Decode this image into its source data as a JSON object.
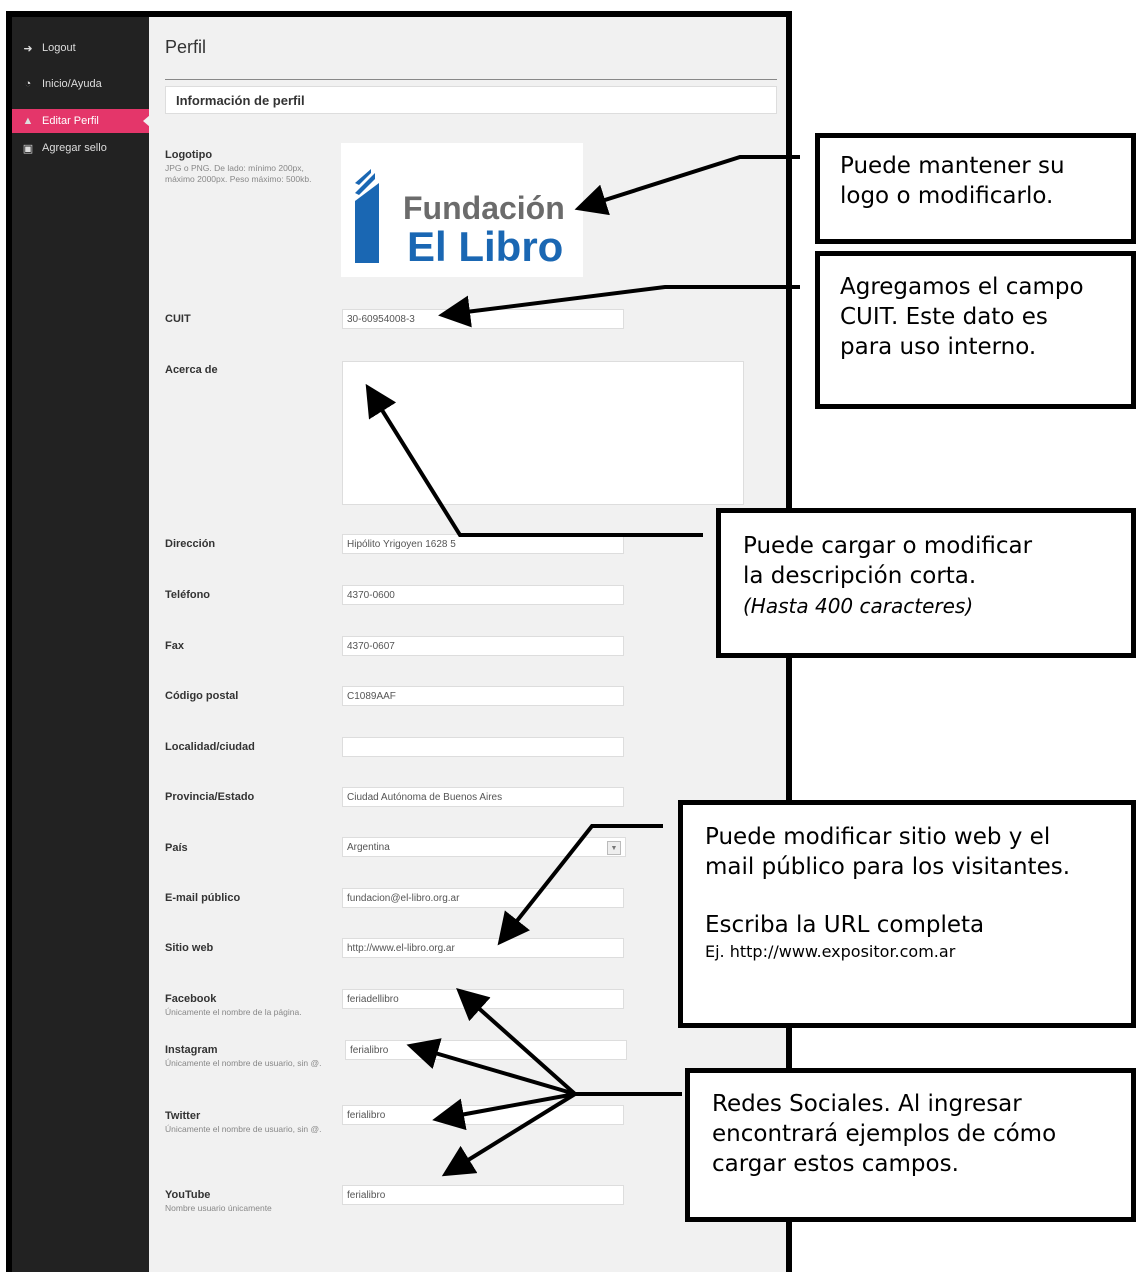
{
  "sidebar": {
    "items": [
      {
        "label": "Logout",
        "icon": "logout-icon"
      },
      {
        "label": "Inicio/Ayuda",
        "icon": "dashboard-icon"
      },
      {
        "label": "Editar Perfil",
        "icon": "user-icon"
      },
      {
        "label": "Agregar sello",
        "icon": "stamp-icon"
      }
    ],
    "active_color": "#e4366a"
  },
  "main": {
    "title": "Perfil",
    "section": "Información de perfil",
    "logo": {
      "label": "Logotipo",
      "hint": "JPG o PNG. De lado: mínimo 200px, máximo 2000px. Peso máximo: 500kb.",
      "brand_line1": "Fundación",
      "brand_line2": "El Libro"
    },
    "fields": {
      "cuit": {
        "label": "CUIT",
        "value": "30-60954008-3"
      },
      "acerca": {
        "label": "Acerca de",
        "value": ""
      },
      "direccion": {
        "label": "Dirección",
        "value": "Hipólito Yrigoyen 1628 5"
      },
      "telefono": {
        "label": "Teléfono",
        "value": "4370-0600"
      },
      "fax": {
        "label": "Fax",
        "value": "4370-0607"
      },
      "cp": {
        "label": "Código postal",
        "value": "C1089AAF"
      },
      "localidad": {
        "label": "Localidad/ciudad",
        "value": ""
      },
      "provincia": {
        "label": "Provincia/Estado",
        "value": "Ciudad Autónoma de Buenos Aires"
      },
      "pais": {
        "label": "País",
        "value": "Argentina"
      },
      "email": {
        "label": "E-mail público",
        "value": "fundacion@el-libro.org.ar"
      },
      "web": {
        "label": "Sitio web",
        "value": "http://www.el-libro.org.ar"
      },
      "facebook": {
        "label": "Facebook",
        "hint": "Únicamente el nombre de la página.",
        "value": "feriadellibro"
      },
      "instagram": {
        "label": "Instagram",
        "hint": "Únicamente el nombre de usuario, sin @.",
        "value": "ferialibro"
      },
      "twitter": {
        "label": "Twitter",
        "hint": "Únicamente el nombre de usuario, sin @.",
        "value": "ferialibro"
      },
      "youtube": {
        "label": "YouTube",
        "hint": "Nombre usuario únicamente",
        "value": "ferialibro"
      }
    }
  },
  "callouts": {
    "logo": {
      "line1": "Puede mantener su",
      "line2": "logo o modificarlo."
    },
    "cuit": {
      "line1": "Agregamos el campo",
      "line2": "CUIT. Este dato es",
      "line3": "para uso interno."
    },
    "acerca": {
      "line1": "Puede cargar o modificar",
      "line2": "la descripción corta.",
      "line3": "(Hasta 400 caracteres)"
    },
    "web": {
      "line1": "Puede modificar sitio web y el",
      "line2": "mail público para los visitantes.",
      "line3": "Escriba la URL completa",
      "line4": "Ej. http://www.expositor.com.ar"
    },
    "redes": {
      "line1": "Redes Sociales. Al ingresar",
      "line2": "encontrará ejemplos de cómo",
      "line3": "cargar estos campos."
    }
  }
}
